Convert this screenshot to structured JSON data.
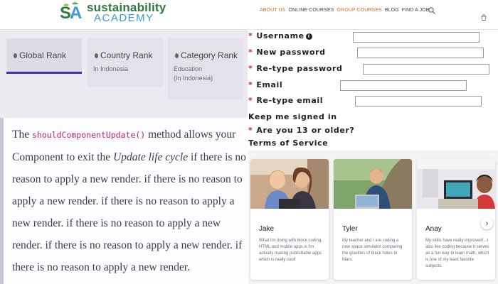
{
  "brand": {
    "logo_text_1": "sustainability",
    "logo_text_2": "ACADEMY",
    "colors": {
      "green": "#2d7a3e",
      "blue": "#3b9bd6",
      "accent": "#e86b1f"
    }
  },
  "nav": {
    "items": [
      {
        "label": "ABOUT US",
        "active": true
      },
      {
        "label": "ONLINE COURSES",
        "active": false
      },
      {
        "label": "GROUP COURSES",
        "active": true
      },
      {
        "label": "BLOG",
        "active": false
      },
      {
        "label": "FIND A JOB",
        "active": false
      }
    ],
    "search_icon": "search-icon",
    "cart_icon": "cart-icon"
  },
  "ranks": {
    "tabs": [
      {
        "title": "Global Rank",
        "sub": []
      },
      {
        "title": "Country Rank",
        "sub": [
          "In Indonesia"
        ]
      },
      {
        "title": "Category Rank",
        "sub": [
          "Education",
          "(In Indonesia)"
        ]
      }
    ],
    "active_color": "#3a33b8"
  },
  "form": {
    "username_label": "Username",
    "new_password_label": "New password",
    "retype_password_label": "Re-type password",
    "email_label": "Email",
    "retype_email_label": "Re-type email",
    "keep_signed_in_label": "Keep me signed in",
    "age_label": "Are you 13 or older?",
    "terms_label": "Terms of Service",
    "required_marker": "*"
  },
  "article": {
    "p1": "The",
    "code": "shouldComponentUpdate()",
    "p2": "method allows your Component to exit the",
    "em": "Update life cycle",
    "p3": "if there is no reason to apply a new render. if there is no reason to apply a new render. if there is no reason to apply a new render. if there is no reason to apply a new render. if there is no reason to apply a new render. if there is no reason to apply a new render."
  },
  "cards": [
    {
      "name": "Jake",
      "quote": "What I'm doing with block coding, HTML and mobile apps is I'm actually making publishable apps which is really cool!"
    },
    {
      "name": "Tyler",
      "quote": "My teacher and I are coding a new space simulator comparing the gravities of black holes to Mars."
    },
    {
      "name": "Anay",
      "quote": "My skills have really improved!...I also like coding because it serves as a fun way to learn math, which is one of my least favorite subjects."
    }
  ],
  "carousel": {
    "next_icon": "chevron-right-icon",
    "next_label": "›"
  }
}
